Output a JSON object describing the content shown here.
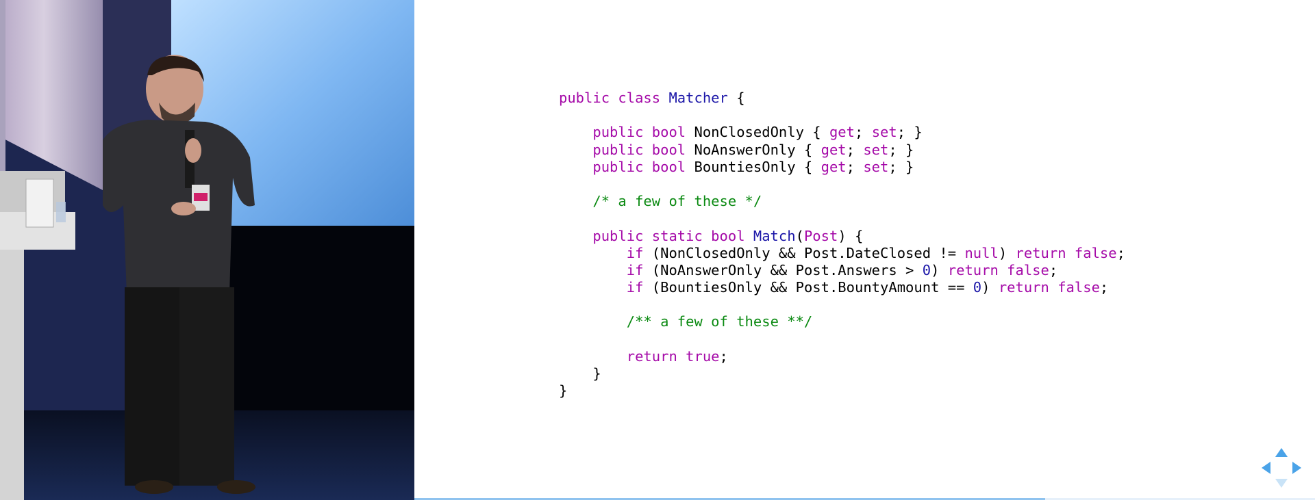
{
  "slide": {
    "code_lines": [
      [
        [
          "public class ",
          "kw"
        ],
        [
          "Matcher",
          "ty"
        ],
        [
          " {",
          ""
        ]
      ],
      [],
      [
        [
          "    ",
          ""
        ],
        [
          "public bool ",
          "kw"
        ],
        [
          "NonClosedOnly { ",
          ""
        ],
        [
          "get",
          "kw"
        ],
        [
          "; ",
          ""
        ],
        [
          "set",
          "kw"
        ],
        [
          "; }",
          ""
        ]
      ],
      [
        [
          "    ",
          ""
        ],
        [
          "public bool ",
          "kw"
        ],
        [
          "NoAnswerOnly { ",
          ""
        ],
        [
          "get",
          "kw"
        ],
        [
          "; ",
          ""
        ],
        [
          "set",
          "kw"
        ],
        [
          "; }",
          ""
        ]
      ],
      [
        [
          "    ",
          ""
        ],
        [
          "public bool ",
          "kw"
        ],
        [
          "BountiesOnly { ",
          ""
        ],
        [
          "get",
          "kw"
        ],
        [
          "; ",
          ""
        ],
        [
          "set",
          "kw"
        ],
        [
          "; }",
          ""
        ]
      ],
      [],
      [
        [
          "    ",
          ""
        ],
        [
          "/* a few of these */",
          "cm"
        ]
      ],
      [],
      [
        [
          "    ",
          ""
        ],
        [
          "public static bool ",
          "kw"
        ],
        [
          "Match",
          "ty"
        ],
        [
          "(",
          ""
        ],
        [
          "Post",
          "kw"
        ],
        [
          ") {",
          ""
        ]
      ],
      [
        [
          "        ",
          ""
        ],
        [
          "if ",
          "kw"
        ],
        [
          "(NonClosedOnly && Post.DateClosed != ",
          ""
        ],
        [
          "null",
          "kw"
        ],
        [
          ") ",
          ""
        ],
        [
          "return false",
          "kw"
        ],
        [
          ";",
          ""
        ]
      ],
      [
        [
          "        ",
          ""
        ],
        [
          "if ",
          "kw"
        ],
        [
          "(NoAnswerOnly && Post.Answers > ",
          ""
        ],
        [
          "0",
          "num"
        ],
        [
          ") ",
          ""
        ],
        [
          "return false",
          "kw"
        ],
        [
          ";",
          ""
        ]
      ],
      [
        [
          "        ",
          ""
        ],
        [
          "if ",
          "kw"
        ],
        [
          "(BountiesOnly && Post.BountyAmount == ",
          ""
        ],
        [
          "0",
          "num"
        ],
        [
          ") ",
          ""
        ],
        [
          "return false",
          "kw"
        ],
        [
          ";",
          ""
        ]
      ],
      [],
      [
        [
          "        ",
          ""
        ],
        [
          "/** a few of these **/",
          "cm"
        ]
      ],
      [],
      [
        [
          "        ",
          ""
        ],
        [
          "return true",
          "kw"
        ],
        [
          ";",
          ""
        ]
      ],
      [
        [
          "    }",
          ""
        ]
      ],
      [
        [
          "}",
          ""
        ]
      ]
    ],
    "progress_fraction": 0.7
  },
  "controls": {
    "icons": [
      "nav-up-icon",
      "nav-left-icon",
      "nav-right-icon",
      "nav-down-icon"
    ]
  },
  "colors": {
    "keyword": "#a50aa8",
    "type": "#1b16a8",
    "comment": "#0b8a12",
    "progress": "#8fc3ef",
    "controls": "#4aa3e8"
  }
}
